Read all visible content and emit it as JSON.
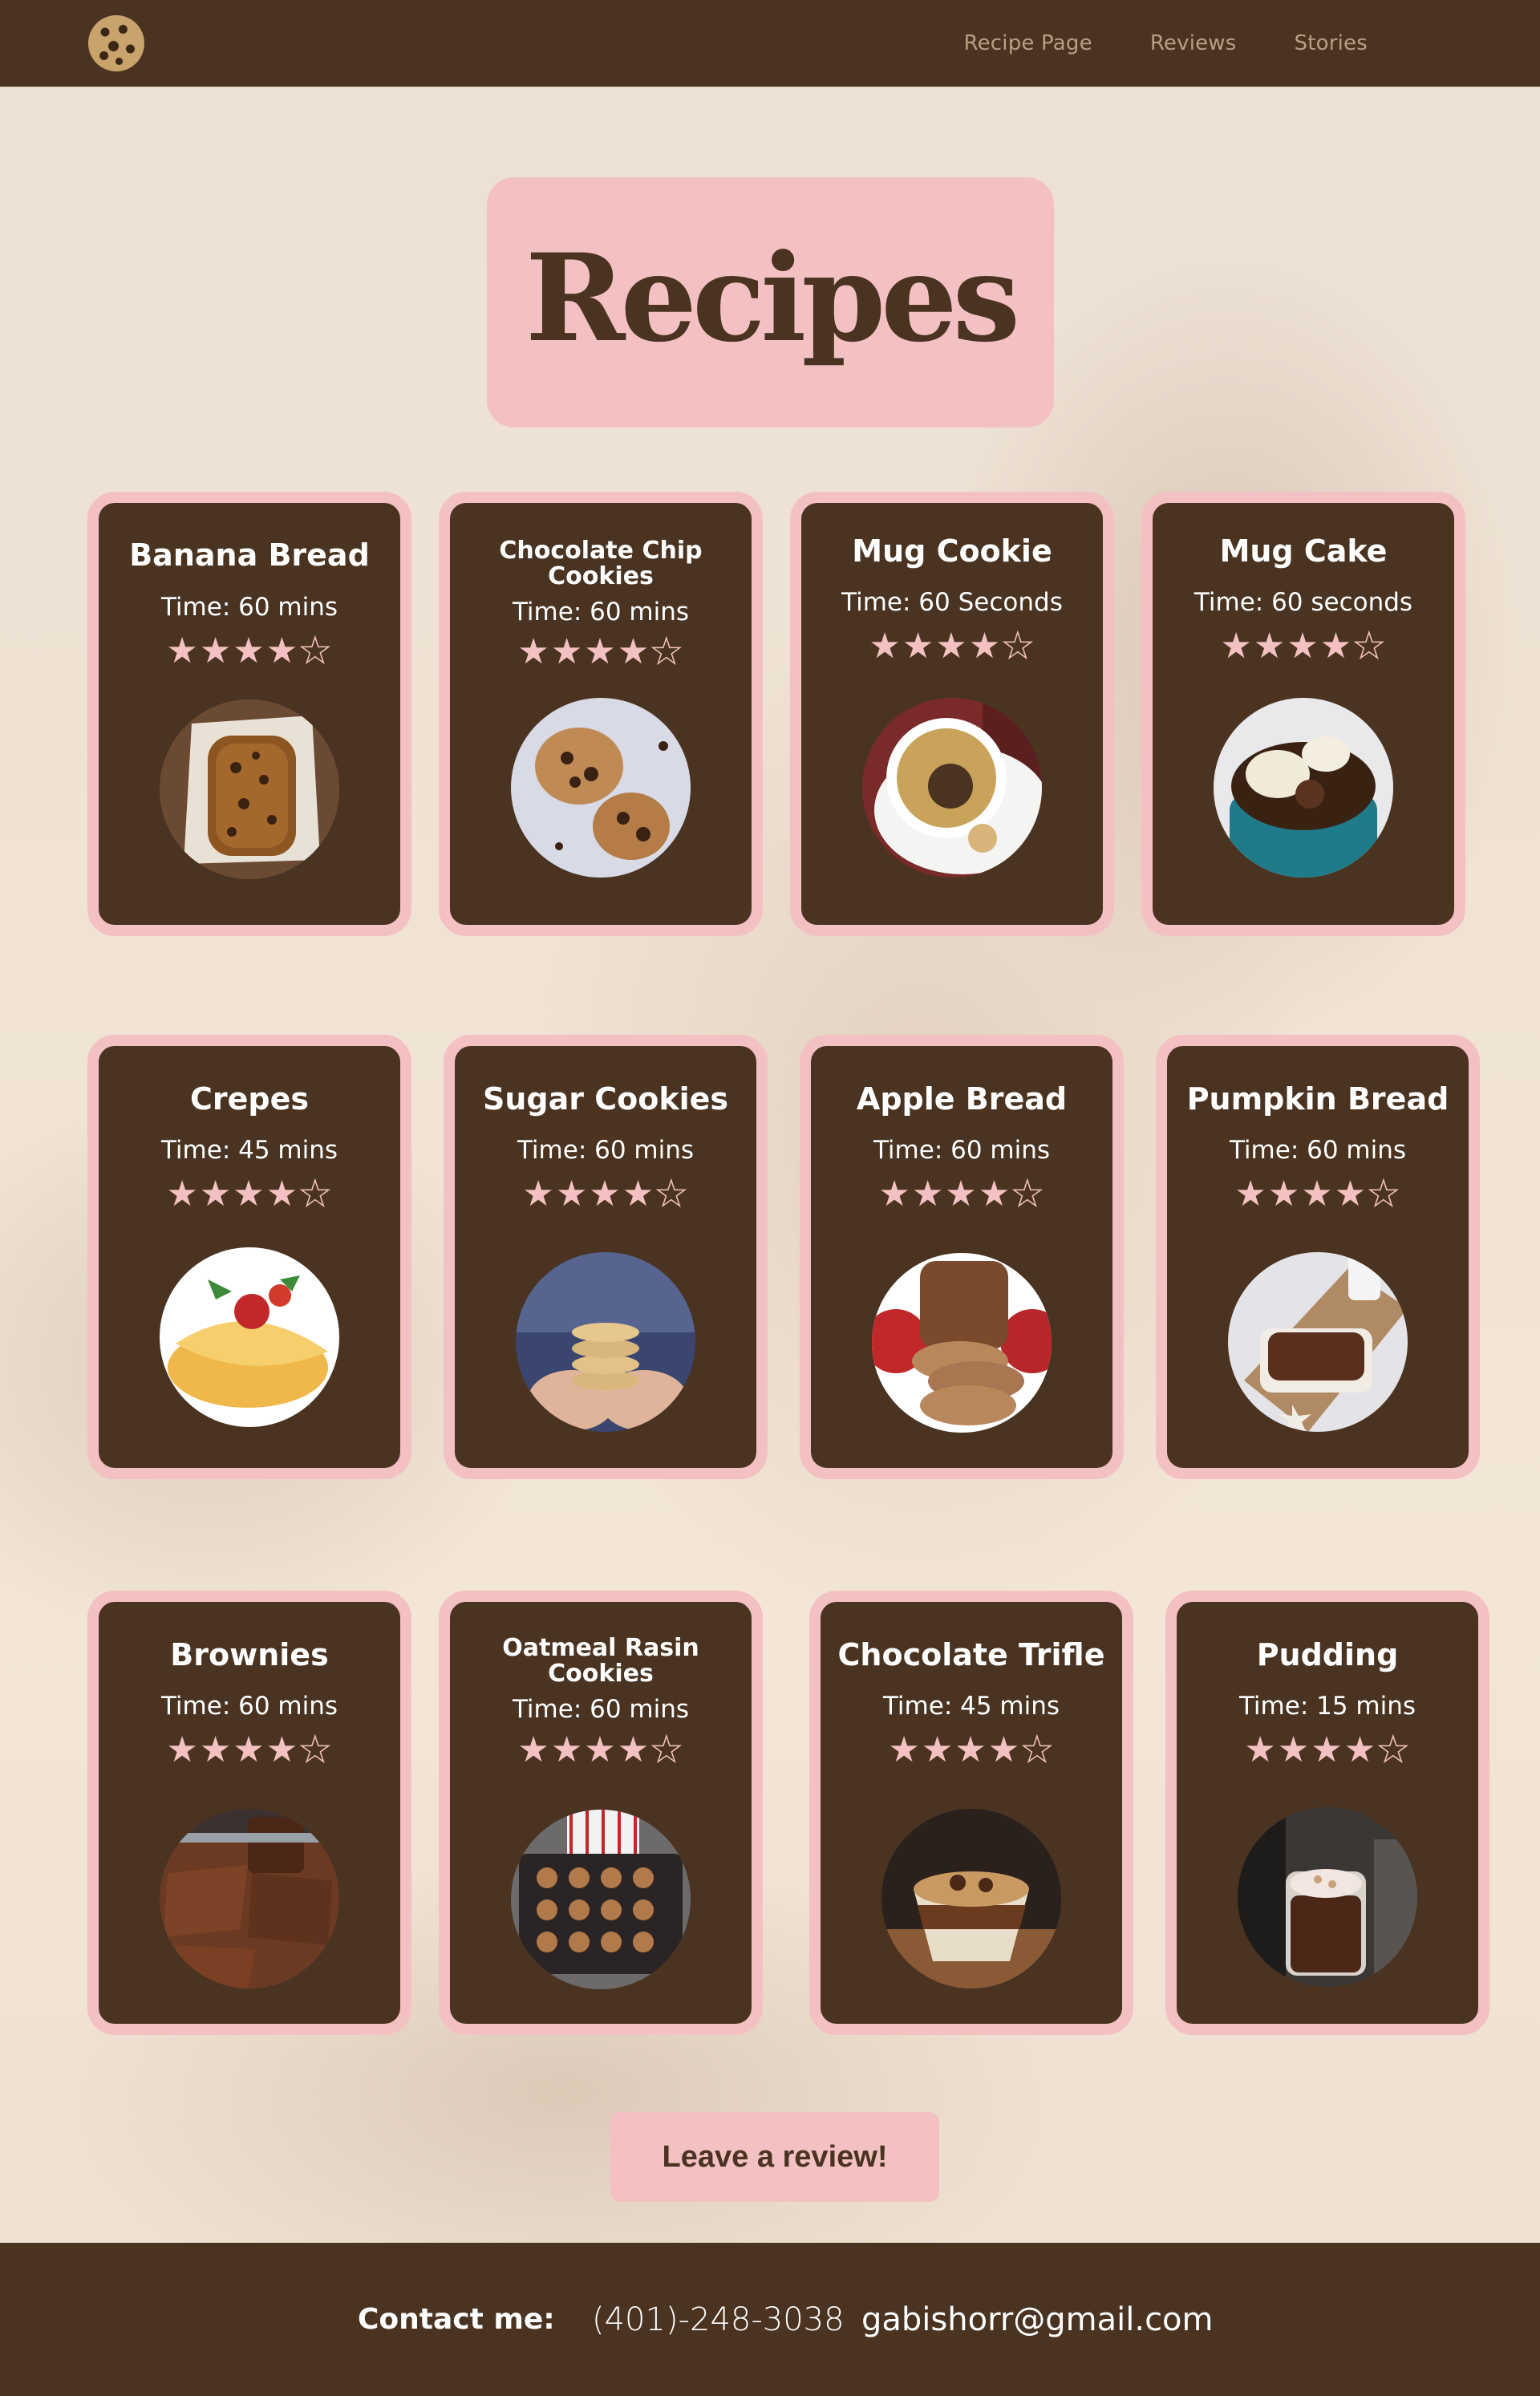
{
  "nav": {
    "logo": "cookie-icon",
    "links": [
      "Recipe Page",
      "Reviews",
      "Stories"
    ]
  },
  "page_title": "Recipes",
  "colors": {
    "brown": "#4a3421",
    "pink": "#f3c1c1",
    "nav_link": "#b79f86"
  },
  "recipes": [
    {
      "title": "Banana Bread",
      "time": "Time: 60 mins",
      "rating": 4,
      "max_rating": 5,
      "image": "banana-bread-photo"
    },
    {
      "title": "Chocolate Chip Cookies",
      "time": "Time: 60 mins",
      "rating": 4,
      "max_rating": 5,
      "image": "chocolate-chip-cookies-photo"
    },
    {
      "title": "Mug Cookie",
      "time": "Time: 60 Seconds",
      "rating": 4,
      "max_rating": 5,
      "image": "mug-cookie-photo"
    },
    {
      "title": "Mug Cake",
      "time": "Time: 60 seconds",
      "rating": 4,
      "max_rating": 5,
      "image": "mug-cake-photo"
    },
    {
      "title": "Crepes",
      "time": "Time: 45 mins",
      "rating": 4,
      "max_rating": 5,
      "image": "crepes-photo"
    },
    {
      "title": "Sugar Cookies",
      "time": "Time: 60 mins",
      "rating": 4,
      "max_rating": 5,
      "image": "sugar-cookies-photo"
    },
    {
      "title": "Apple Bread",
      "time": "Time: 60 mins",
      "rating": 4,
      "max_rating": 5,
      "image": "apple-bread-photo"
    },
    {
      "title": "Pumpkin Bread",
      "time": "Time: 60 mins",
      "rating": 4,
      "max_rating": 5,
      "image": "pumpkin-bread-photo"
    },
    {
      "title": "Brownies",
      "time": "Time: 60 mins",
      "rating": 4,
      "max_rating": 5,
      "image": "brownies-photo"
    },
    {
      "title": "Oatmeal Rasin Cookies",
      "time": "Time: 60 mins",
      "rating": 4,
      "max_rating": 5,
      "image": "oatmeal-raisin-cookies-photo"
    },
    {
      "title": "Chocolate Trifle",
      "time": "Time: 45 mins",
      "rating": 4,
      "max_rating": 5,
      "image": "chocolate-trifle-photo"
    },
    {
      "title": "Pudding",
      "time": "Time: 15 mins",
      "rating": 4,
      "max_rating": 5,
      "image": "pudding-photo"
    }
  ],
  "review_button": "Leave a review!",
  "footer": {
    "contact_label": "Contact me:",
    "phone": "(401)-248-3038",
    "email": "gabishorr@gmail.com"
  }
}
